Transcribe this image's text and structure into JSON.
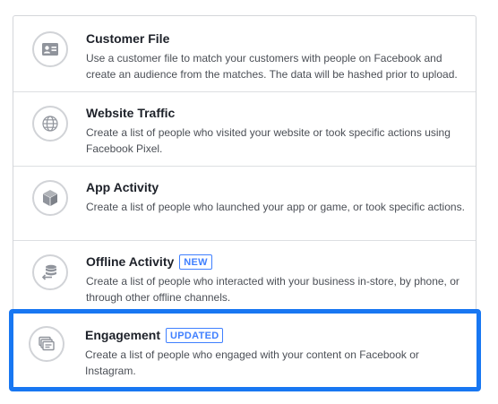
{
  "options": [
    {
      "title": "Customer File",
      "description": "Use a customer file to match your customers with people on Facebook and create an audience from the matches. The data will be hashed prior to upload.",
      "icon": "contact-card-icon"
    },
    {
      "title": "Website Traffic",
      "description": "Create a list of people who visited your website or took specific actions using Facebook Pixel.",
      "icon": "globe-icon"
    },
    {
      "title": "App Activity",
      "description": "Create a list of people who launched your app or game, or took specific actions.",
      "icon": "cube-icon"
    },
    {
      "title": "Offline Activity",
      "badge": "NEW",
      "description": "Create a list of people who interacted with your business in-store, by phone, or through other offline channels.",
      "icon": "database-arrow-icon"
    },
    {
      "title": "Engagement",
      "badge": "UPDATED",
      "description": "Create a list of people who engaged with your content on Facebook or Instagram.",
      "icon": "stacked-cards-icon",
      "highlight_color": "#1877f2"
    }
  ],
  "colors": {
    "badge": "#4080ff",
    "title": "#1d2129",
    "description": "#4b4f56",
    "icon": "#90949c"
  }
}
